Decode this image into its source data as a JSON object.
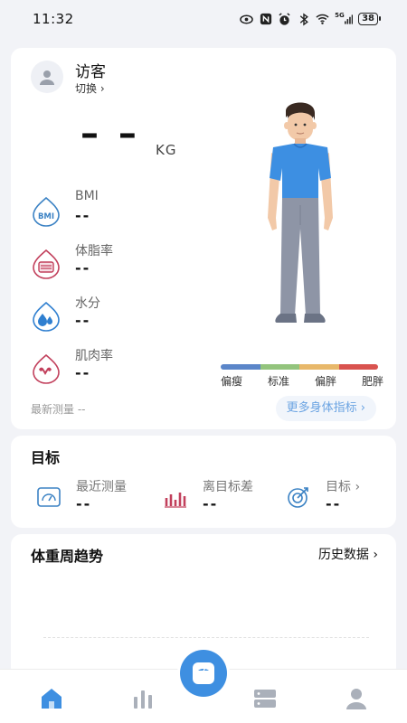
{
  "status_bar": {
    "time": "11:32",
    "network": "5G",
    "battery": "38"
  },
  "profile": {
    "name": "访客",
    "switch_label": "切换 ›"
  },
  "weight": {
    "value": "– –",
    "unit": "KG"
  },
  "metrics": [
    {
      "label": "BMI",
      "value": "--",
      "icon": "bmi-icon",
      "color": "#3b82c4"
    },
    {
      "label": "体脂率",
      "value": "--",
      "icon": "body-fat-icon",
      "color": "#c2405c"
    },
    {
      "label": "水分",
      "value": "--",
      "icon": "water-icon",
      "color": "#2f7fd0"
    },
    {
      "label": "肌肉率",
      "value": "--",
      "icon": "muscle-icon",
      "color": "#c2405c"
    }
  ],
  "bmi_scale": {
    "labels": [
      "偏瘦",
      "标准",
      "偏胖",
      "肥胖"
    ],
    "colors": [
      "#5b86c9",
      "#93c47d",
      "#e8b86a",
      "#d9534f"
    ]
  },
  "latest_measure": "最新测量 --",
  "more_indicators": "更多身体指标 ›",
  "target": {
    "title": "目标",
    "stats": [
      {
        "label": "最近测量",
        "value": "--",
        "icon": "gauge-icon"
      },
      {
        "label": "离目标差",
        "value": "--",
        "icon": "bar-chart-icon"
      },
      {
        "label": "目标 ›",
        "value": "--",
        "icon": "target-icon"
      }
    ]
  },
  "trend": {
    "title": "体重周趋势",
    "history_label": "历史数据 ›"
  },
  "nav": {
    "items": [
      "home-icon",
      "stats-icon",
      "scale-icon",
      "devices-icon",
      "profile-icon"
    ],
    "active_color": "#3e8fe1"
  }
}
